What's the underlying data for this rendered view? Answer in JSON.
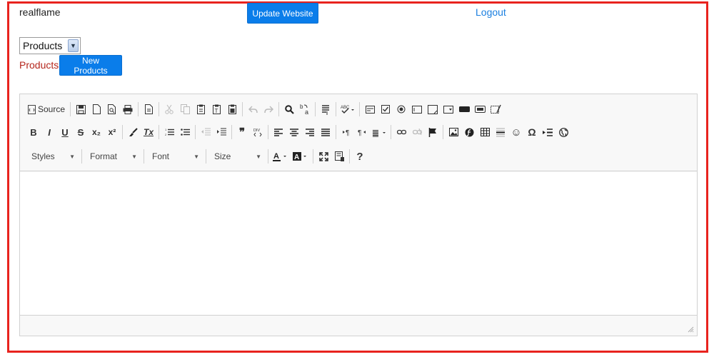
{
  "header": {
    "username": "realflame",
    "update_label": "Update Website",
    "logout_label": "Logout"
  },
  "selector": {
    "selected": "Products"
  },
  "section": {
    "label": "Products",
    "new_button": "New Products"
  },
  "editor": {
    "source_label": "Source",
    "combos": {
      "styles": "Styles",
      "format": "Format",
      "font": "Font",
      "size": "Size"
    },
    "glyphs": {
      "bold": "B",
      "italic": "I",
      "underline": "U",
      "strike": "S",
      "subscript": "x₂",
      "superscript": "x²",
      "remove_format": "Tx",
      "blockquote": "❞",
      "omega": "Ω",
      "help": "?",
      "smiley": "☺"
    }
  },
  "colors": {
    "accent": "#0a7dea",
    "frame": "#e8231e",
    "section_label": "#b5261c",
    "link": "#1a7fe0"
  }
}
